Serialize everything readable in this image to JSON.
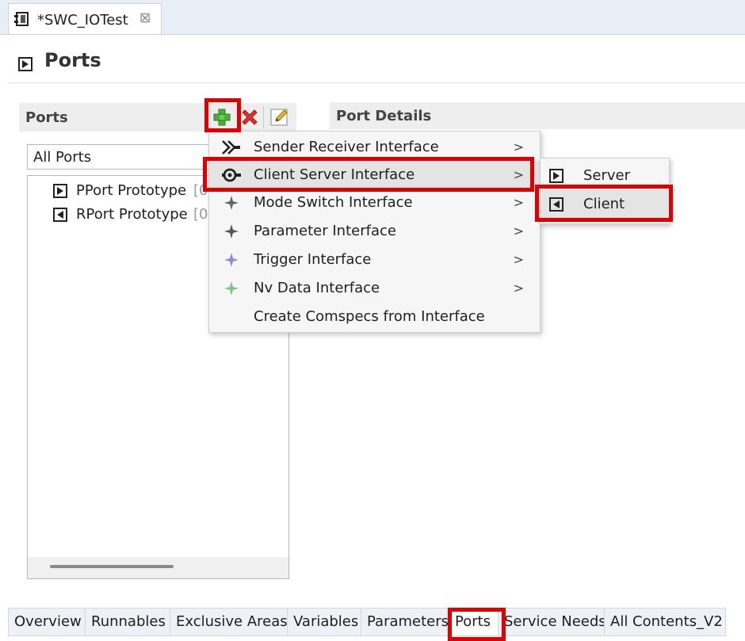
{
  "editor": {
    "tab_label": "*SWC_IOTest",
    "close_glyph": "⊠"
  },
  "page": {
    "title": "Ports"
  },
  "ports_panel": {
    "title": "Ports",
    "filter_value": "All Ports",
    "tree": [
      {
        "label": "PPort Prototype",
        "count": "[0"
      },
      {
        "label": "RPort Prototype",
        "count": "[0"
      }
    ]
  },
  "details_panel": {
    "title": "Port Details"
  },
  "add_menu": {
    "items": [
      {
        "label": "Sender Receiver Interface",
        "icon": "sender-receiver-icon",
        "has_submenu": true
      },
      {
        "label": "Client Server Interface",
        "icon": "client-server-icon",
        "has_submenu": true,
        "selected": true
      },
      {
        "label": "Mode Switch Interface",
        "icon": "mode-switch-icon",
        "has_submenu": true
      },
      {
        "label": "Parameter Interface",
        "icon": "parameter-icon",
        "has_submenu": true
      },
      {
        "label": "Trigger Interface",
        "icon": "trigger-icon",
        "has_submenu": true
      },
      {
        "label": "Nv Data Interface",
        "icon": "nv-data-icon",
        "has_submenu": true
      },
      {
        "label": "Create Comspecs from Interface",
        "icon": "",
        "has_submenu": false
      }
    ],
    "arrow_glyph": ">"
  },
  "submenu": {
    "items": [
      {
        "label": "Server",
        "icon": "pport-icon"
      },
      {
        "label": "Client",
        "icon": "rport-icon",
        "selected": true
      }
    ]
  },
  "bottom_tabs": [
    {
      "label": "Overview"
    },
    {
      "label": "Runnables"
    },
    {
      "label": "Exclusive Areas"
    },
    {
      "label": "Variables"
    },
    {
      "label": "Parameters"
    },
    {
      "label": "Ports",
      "active": true
    },
    {
      "label": "Service Needs"
    },
    {
      "label": "All Contents_V2"
    }
  ],
  "colors": {
    "highlight": "#e00000",
    "add_green": "#4cae3a",
    "delete_red": "#d9342b"
  }
}
